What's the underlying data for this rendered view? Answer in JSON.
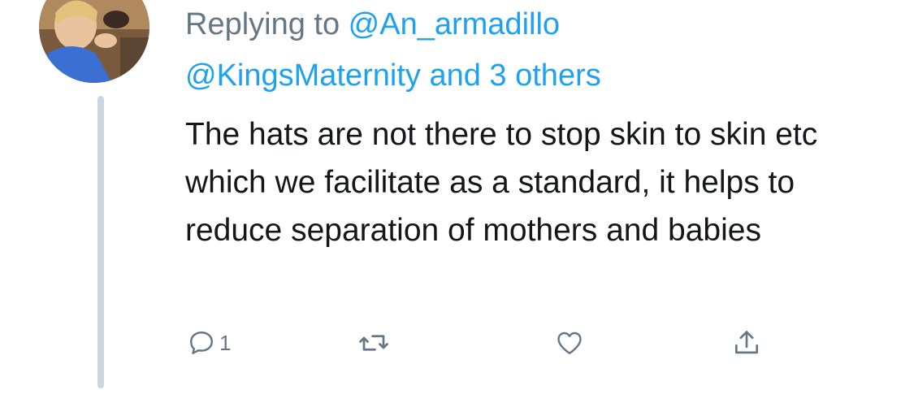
{
  "tweet": {
    "replying_prefix": "Replying to ",
    "replying_handle": "@An_armadillo",
    "mentions_handle": "@KingsMaternity",
    "mentions_suffix": " and 3 others",
    "text": "The hats are not there to stop skin to skin etc which we facilitate as a standard, it helps to reduce separation of mothers and babies",
    "reply_count": "1"
  },
  "colors": {
    "link": "#1da1f2",
    "muted": "#657786",
    "text": "#14171a",
    "thread_line": "#ccd6dd"
  },
  "icons": {
    "reply": "reply-icon",
    "retweet": "retweet-icon",
    "like": "heart-icon",
    "share": "share-icon"
  }
}
